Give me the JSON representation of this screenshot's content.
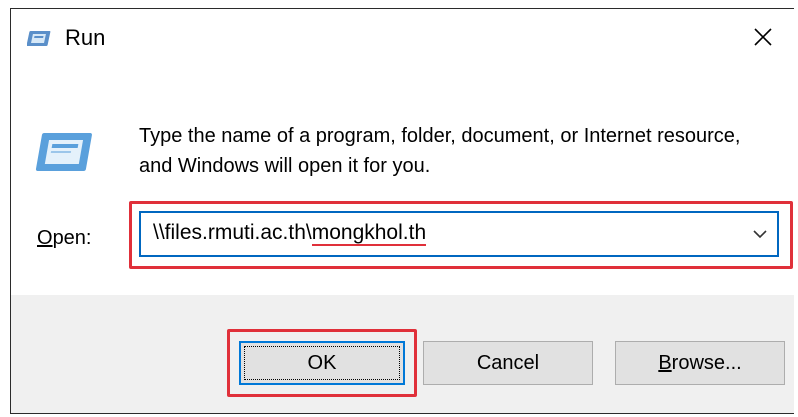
{
  "window": {
    "title": "Run",
    "description": "Type the name of a program, folder, document, or Internet resource, and Windows will open it for you."
  },
  "open_field": {
    "label_accel": "O",
    "label_rest": "pen:",
    "value_prefix": "\\\\files.rmuti.ac.th\\",
    "value_highlighted": "mongkhol.th"
  },
  "buttons": {
    "ok": "OK",
    "cancel": "Cancel",
    "browse_accel": "B",
    "browse_rest": "rowse..."
  },
  "icons": [
    "run-icon",
    "close-icon",
    "chevron-down-icon"
  ],
  "colors": {
    "highlight": "#e0303a",
    "focus_border": "#0078d7",
    "footer_bg": "#f0f0f0"
  }
}
